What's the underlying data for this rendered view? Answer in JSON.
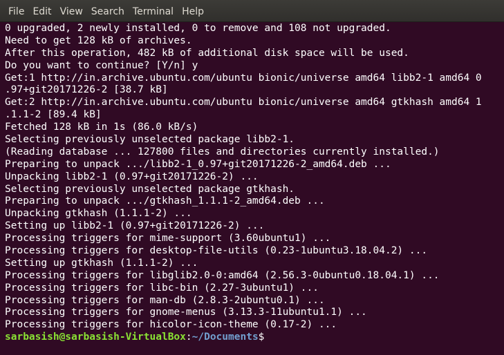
{
  "menubar": {
    "items": [
      "File",
      "Edit",
      "View",
      "Search",
      "Terminal",
      "Help"
    ]
  },
  "terminal": {
    "lines": [
      "0 upgraded, 2 newly installed, 0 to remove and 108 not upgraded.",
      "Need to get 128 kB of archives.",
      "After this operation, 482 kB of additional disk space will be used.",
      "Do you want to continue? [Y/n] y",
      "Get:1 http://in.archive.ubuntu.com/ubuntu bionic/universe amd64 libb2-1 amd64 0",
      ".97+git20171226-2 [38.7 kB]",
      "Get:2 http://in.archive.ubuntu.com/ubuntu bionic/universe amd64 gtkhash amd64 1",
      ".1.1-2 [89.4 kB]",
      "Fetched 128 kB in 1s (86.0 kB/s)",
      "Selecting previously unselected package libb2-1.",
      "(Reading database ... 127800 files and directories currently installed.)",
      "Preparing to unpack .../libb2-1_0.97+git20171226-2_amd64.deb ...",
      "Unpacking libb2-1 (0.97+git20171226-2) ...",
      "Selecting previously unselected package gtkhash.",
      "Preparing to unpack .../gtkhash_1.1.1-2_amd64.deb ...",
      "Unpacking gtkhash (1.1.1-2) ...",
      "Setting up libb2-1 (0.97+git20171226-2) ...",
      "Processing triggers for mime-support (3.60ubuntu1) ...",
      "Processing triggers for desktop-file-utils (0.23-1ubuntu3.18.04.2) ...",
      "Setting up gtkhash (1.1.1-2) ...",
      "Processing triggers for libglib2.0-0:amd64 (2.56.3-0ubuntu0.18.04.1) ...",
      "Processing triggers for libc-bin (2.27-3ubuntu1) ...",
      "Processing triggers for man-db (2.8.3-2ubuntu0.1) ...",
      "Processing triggers for gnome-menus (3.13.3-11ubuntu1.1) ...",
      "Processing triggers for hicolor-icon-theme (0.17-2) ..."
    ],
    "prompt": {
      "user_host": "sarbasish@sarbasish-VirtualBox",
      "separator": ":",
      "path": "~/Documents",
      "symbol": "$"
    }
  },
  "colors": {
    "background": "#300a24",
    "text": "#ffffff",
    "prompt_user": "#8ae234",
    "prompt_path": "#729fcf",
    "menubar": "#3c3b37"
  }
}
